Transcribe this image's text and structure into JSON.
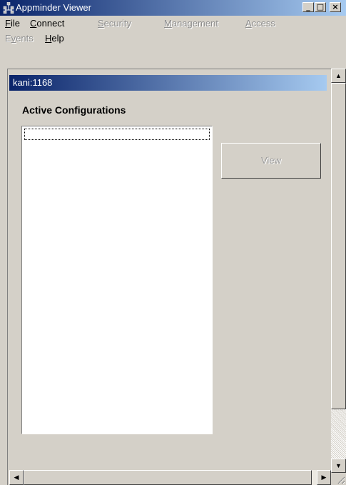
{
  "window": {
    "title": "Appminder Viewer",
    "minimize": "_",
    "maximize": "□",
    "close": "×"
  },
  "menu": [
    {
      "label_pre": "",
      "accel": "F",
      "label_post": "ile",
      "enabled": true
    },
    {
      "label_pre": "",
      "accel": "C",
      "label_post": "onnect",
      "enabled": true
    },
    {
      "label_pre": "",
      "accel": "S",
      "label_post": "ecurity",
      "enabled": false
    },
    {
      "label_pre": "",
      "accel": "M",
      "label_post": "anagement",
      "enabled": false
    },
    {
      "label_pre": "",
      "accel": "A",
      "label_post": "ccess",
      "enabled": false
    },
    {
      "label_pre": "E",
      "accel": "v",
      "label_post": "ents",
      "enabled": false
    },
    {
      "label_pre": "",
      "accel": "H",
      "label_post": "elp",
      "enabled": true
    }
  ],
  "panel": {
    "title": "kani:1168",
    "section_label": "Active Configurations",
    "view_button": "View"
  },
  "scroll": {
    "up": "▲",
    "down": "▼",
    "left": "◀",
    "right": "▶"
  }
}
